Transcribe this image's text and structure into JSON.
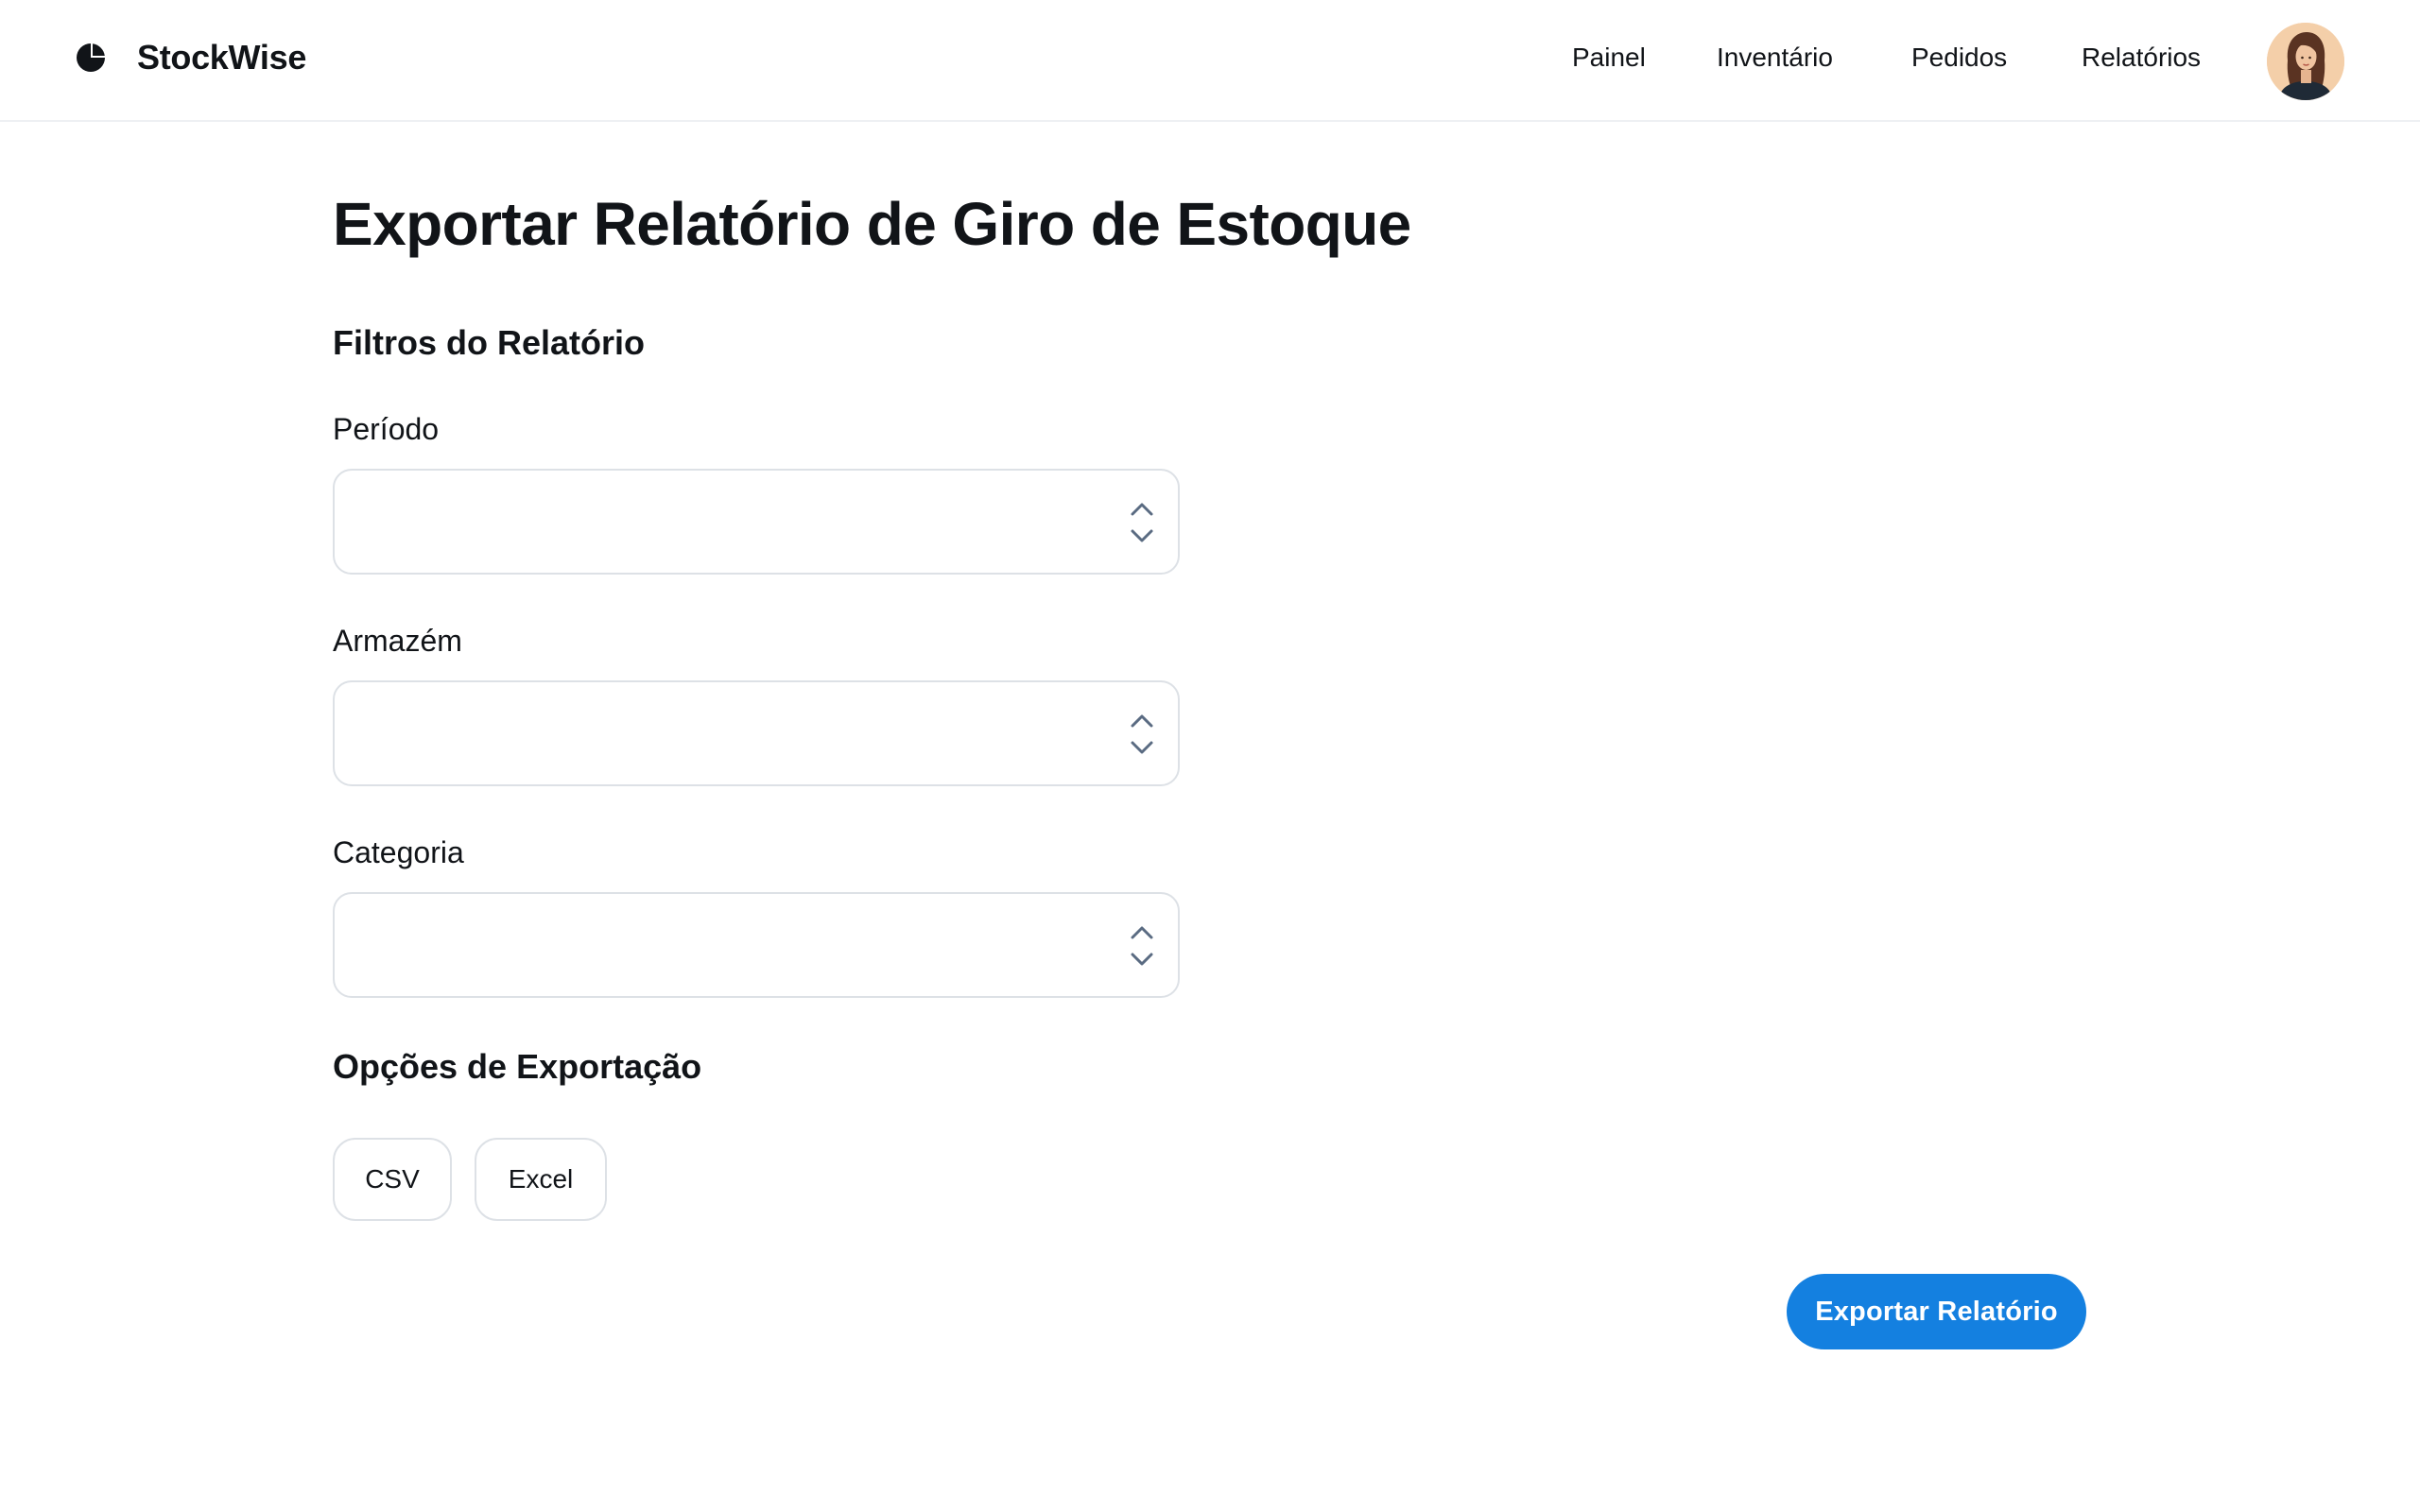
{
  "header": {
    "brand": "StockWise",
    "nav": [
      {
        "label": "Painel"
      },
      {
        "label": "Inventário"
      },
      {
        "label": "Pedidos"
      },
      {
        "label": "Relatórios"
      }
    ],
    "avatar_icon": "user-avatar-photo"
  },
  "main": {
    "title": "Exportar Relatório de Giro de Estoque",
    "filters": {
      "heading": "Filtros do Relatório",
      "fields": [
        {
          "label": "Período",
          "value": ""
        },
        {
          "label": "Armazém",
          "value": ""
        },
        {
          "label": "Categoria",
          "value": ""
        }
      ]
    },
    "export_options": {
      "heading": "Opções de Exportação",
      "formats": [
        "CSV",
        "Excel"
      ]
    },
    "export_button": "Exportar Relatório"
  },
  "colors": {
    "accent": "#1480e0",
    "text": "#111418",
    "border": "#dde1e6",
    "chevron": "#5a6b82"
  }
}
